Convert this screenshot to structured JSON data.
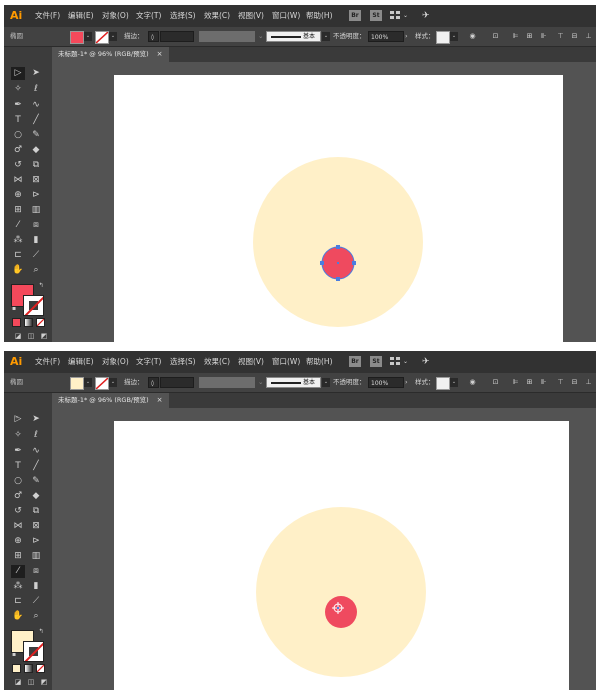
{
  "menu": {
    "app_logo": "Ai",
    "items": [
      "文件(F)",
      "编辑(E)",
      "对象(O)",
      "文字(T)",
      "选择(S)",
      "效果(C)",
      "视图(V)",
      "窗口(W)",
      "帮助(H)"
    ],
    "bridge_label": "Br",
    "stock_label": "St"
  },
  "control": {
    "object_label": "椭圆",
    "stroke_label": "描边：",
    "stroke_style": "基本",
    "opacity_label": "不透明度：",
    "opacity_value": "100%",
    "style_label": "样式："
  },
  "document": {
    "tab_title": "未标题-1* @ 96% (RGB/预览)",
    "close_glyph": "×"
  },
  "screens": [
    {
      "fill_color": "#f4495b",
      "active_tool": "selection",
      "large_circle_color": "#fff0c8",
      "small_circle_color": "#ef4a5f",
      "anchor_color": "#4a7de0",
      "small_circle_selected": true
    },
    {
      "fill_color": "#fff0c8",
      "active_tool": "eyedropper",
      "large_circle_color": "#fff0c8",
      "small_circle_color": "#ef4a5f",
      "anchor_color": "#4a7de0",
      "small_circle_selected": false
    }
  ],
  "icons": {
    "selection": "selection-arrow-icon",
    "direct_selection": "direct-selection-icon",
    "eyedropper": "eyedropper-icon",
    "close": "close-icon"
  }
}
